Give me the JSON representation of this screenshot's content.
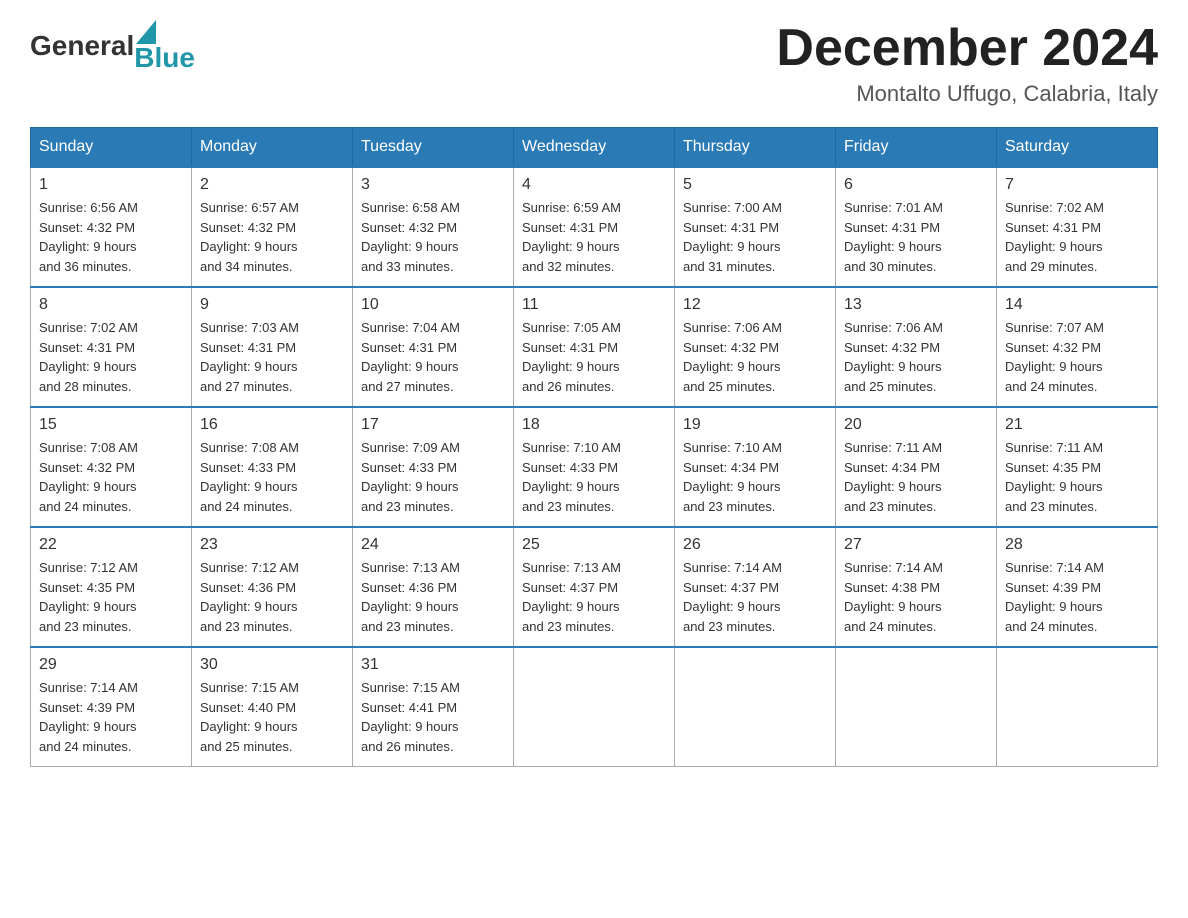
{
  "header": {
    "logo_general": "General",
    "logo_blue": "Blue",
    "month_title": "December 2024",
    "location": "Montalto Uffugo, Calabria, Italy"
  },
  "days_of_week": [
    "Sunday",
    "Monday",
    "Tuesday",
    "Wednesday",
    "Thursday",
    "Friday",
    "Saturday"
  ],
  "weeks": [
    [
      {
        "day": "1",
        "sunrise": "6:56 AM",
        "sunset": "4:32 PM",
        "daylight": "9 hours and 36 minutes."
      },
      {
        "day": "2",
        "sunrise": "6:57 AM",
        "sunset": "4:32 PM",
        "daylight": "9 hours and 34 minutes."
      },
      {
        "day": "3",
        "sunrise": "6:58 AM",
        "sunset": "4:32 PM",
        "daylight": "9 hours and 33 minutes."
      },
      {
        "day": "4",
        "sunrise": "6:59 AM",
        "sunset": "4:31 PM",
        "daylight": "9 hours and 32 minutes."
      },
      {
        "day": "5",
        "sunrise": "7:00 AM",
        "sunset": "4:31 PM",
        "daylight": "9 hours and 31 minutes."
      },
      {
        "day": "6",
        "sunrise": "7:01 AM",
        "sunset": "4:31 PM",
        "daylight": "9 hours and 30 minutes."
      },
      {
        "day": "7",
        "sunrise": "7:02 AM",
        "sunset": "4:31 PM",
        "daylight": "9 hours and 29 minutes."
      }
    ],
    [
      {
        "day": "8",
        "sunrise": "7:02 AM",
        "sunset": "4:31 PM",
        "daylight": "9 hours and 28 minutes."
      },
      {
        "day": "9",
        "sunrise": "7:03 AM",
        "sunset": "4:31 PM",
        "daylight": "9 hours and 27 minutes."
      },
      {
        "day": "10",
        "sunrise": "7:04 AM",
        "sunset": "4:31 PM",
        "daylight": "9 hours and 27 minutes."
      },
      {
        "day": "11",
        "sunrise": "7:05 AM",
        "sunset": "4:31 PM",
        "daylight": "9 hours and 26 minutes."
      },
      {
        "day": "12",
        "sunrise": "7:06 AM",
        "sunset": "4:32 PM",
        "daylight": "9 hours and 25 minutes."
      },
      {
        "day": "13",
        "sunrise": "7:06 AM",
        "sunset": "4:32 PM",
        "daylight": "9 hours and 25 minutes."
      },
      {
        "day": "14",
        "sunrise": "7:07 AM",
        "sunset": "4:32 PM",
        "daylight": "9 hours and 24 minutes."
      }
    ],
    [
      {
        "day": "15",
        "sunrise": "7:08 AM",
        "sunset": "4:32 PM",
        "daylight": "9 hours and 24 minutes."
      },
      {
        "day": "16",
        "sunrise": "7:08 AM",
        "sunset": "4:33 PM",
        "daylight": "9 hours and 24 minutes."
      },
      {
        "day": "17",
        "sunrise": "7:09 AM",
        "sunset": "4:33 PM",
        "daylight": "9 hours and 23 minutes."
      },
      {
        "day": "18",
        "sunrise": "7:10 AM",
        "sunset": "4:33 PM",
        "daylight": "9 hours and 23 minutes."
      },
      {
        "day": "19",
        "sunrise": "7:10 AM",
        "sunset": "4:34 PM",
        "daylight": "9 hours and 23 minutes."
      },
      {
        "day": "20",
        "sunrise": "7:11 AM",
        "sunset": "4:34 PM",
        "daylight": "9 hours and 23 minutes."
      },
      {
        "day": "21",
        "sunrise": "7:11 AM",
        "sunset": "4:35 PM",
        "daylight": "9 hours and 23 minutes."
      }
    ],
    [
      {
        "day": "22",
        "sunrise": "7:12 AM",
        "sunset": "4:35 PM",
        "daylight": "9 hours and 23 minutes."
      },
      {
        "day": "23",
        "sunrise": "7:12 AM",
        "sunset": "4:36 PM",
        "daylight": "9 hours and 23 minutes."
      },
      {
        "day": "24",
        "sunrise": "7:13 AM",
        "sunset": "4:36 PM",
        "daylight": "9 hours and 23 minutes."
      },
      {
        "day": "25",
        "sunrise": "7:13 AM",
        "sunset": "4:37 PM",
        "daylight": "9 hours and 23 minutes."
      },
      {
        "day": "26",
        "sunrise": "7:14 AM",
        "sunset": "4:37 PM",
        "daylight": "9 hours and 23 minutes."
      },
      {
        "day": "27",
        "sunrise": "7:14 AM",
        "sunset": "4:38 PM",
        "daylight": "9 hours and 24 minutes."
      },
      {
        "day": "28",
        "sunrise": "7:14 AM",
        "sunset": "4:39 PM",
        "daylight": "9 hours and 24 minutes."
      }
    ],
    [
      {
        "day": "29",
        "sunrise": "7:14 AM",
        "sunset": "4:39 PM",
        "daylight": "9 hours and 24 minutes."
      },
      {
        "day": "30",
        "sunrise": "7:15 AM",
        "sunset": "4:40 PM",
        "daylight": "9 hours and 25 minutes."
      },
      {
        "day": "31",
        "sunrise": "7:15 AM",
        "sunset": "4:41 PM",
        "daylight": "9 hours and 26 minutes."
      },
      null,
      null,
      null,
      null
    ]
  ]
}
